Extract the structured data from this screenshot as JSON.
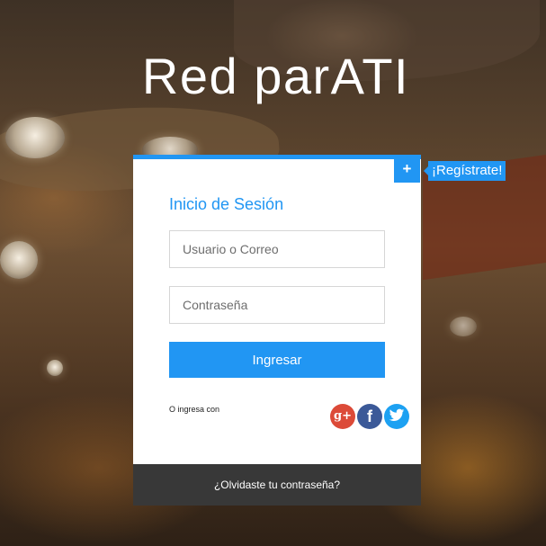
{
  "header": {
    "title": "Red parATI"
  },
  "register": {
    "icon": "plus-icon",
    "label": "¡Regístrate!"
  },
  "login": {
    "title": "Inicio de Sesión",
    "username_placeholder": "Usuario o Correo",
    "password_placeholder": "Contraseña",
    "submit_label": "Ingresar",
    "alt_login_label": "O ingresa con",
    "social": [
      {
        "name": "google-plus-icon",
        "glyph": "g+"
      },
      {
        "name": "facebook-icon",
        "glyph": "f"
      },
      {
        "name": "twitter-icon"
      }
    ],
    "forgot_password": "¿Olvidaste tu contraseña?"
  },
  "colors": {
    "accent": "#2196f3",
    "footer": "#383838",
    "google": "#dc4a38",
    "facebook": "#3b5998",
    "twitter": "#1da1f2"
  }
}
